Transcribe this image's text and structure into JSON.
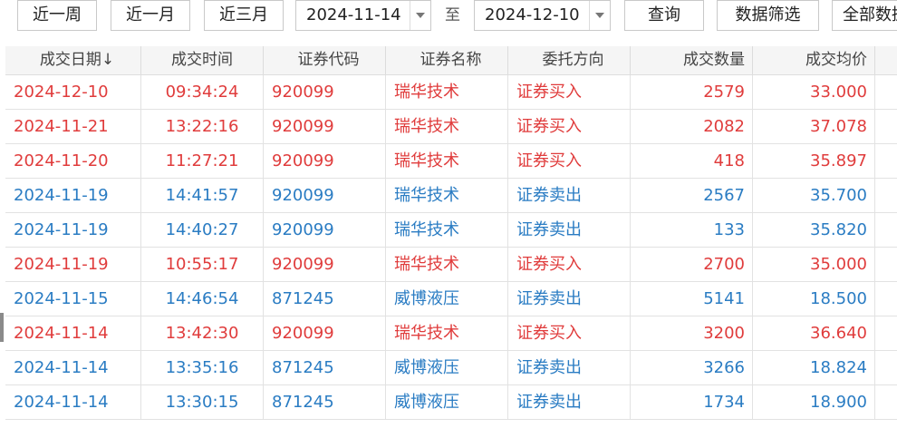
{
  "toolbar": {
    "quick_ranges": [
      "近一周",
      "近一月",
      "近三月"
    ],
    "start_date": "2024-11-14",
    "to_label": "至",
    "end_date": "2024-12-10",
    "query_label": "查询",
    "filter_label": "数据筛选",
    "all_label": "全部数据"
  },
  "colors": {
    "buy": "#e03c3c",
    "sell": "#2a7cc3"
  },
  "table": {
    "columns": [
      "成交日期↓",
      "成交时间",
      "证券代码",
      "证券名称",
      "委托方向",
      "成交数量",
      "成交均价",
      ""
    ],
    "rows": [
      {
        "side": "buy",
        "cells": [
          "2024-12-10",
          "09:34:24",
          "920099",
          "瑞华技术",
          "证券买入",
          "2579",
          "33.000",
          ""
        ]
      },
      {
        "side": "buy",
        "cells": [
          "2024-11-21",
          "13:22:16",
          "920099",
          "瑞华技术",
          "证券买入",
          "2082",
          "37.078",
          ""
        ]
      },
      {
        "side": "buy",
        "cells": [
          "2024-11-20",
          "11:27:21",
          "920099",
          "瑞华技术",
          "证券买入",
          "418",
          "35.897",
          ""
        ]
      },
      {
        "side": "sell",
        "cells": [
          "2024-11-19",
          "14:41:57",
          "920099",
          "瑞华技术",
          "证券卖出",
          "2567",
          "35.700",
          ""
        ]
      },
      {
        "side": "sell",
        "cells": [
          "2024-11-19",
          "14:40:27",
          "920099",
          "瑞华技术",
          "证券卖出",
          "133",
          "35.820",
          ""
        ]
      },
      {
        "side": "buy",
        "cells": [
          "2024-11-19",
          "10:55:17",
          "920099",
          "瑞华技术",
          "证券买入",
          "2700",
          "35.000",
          ""
        ]
      },
      {
        "side": "sell",
        "cells": [
          "2024-11-15",
          "14:46:54",
          "871245",
          "威博液压",
          "证券卖出",
          "5141",
          "18.500",
          ""
        ]
      },
      {
        "side": "buy",
        "cells": [
          "2024-11-14",
          "13:42:30",
          "920099",
          "瑞华技术",
          "证券买入",
          "3200",
          "36.640",
          ""
        ]
      },
      {
        "side": "sell",
        "cells": [
          "2024-11-14",
          "13:35:16",
          "871245",
          "威博液压",
          "证券卖出",
          "3266",
          "18.824",
          ""
        ]
      },
      {
        "side": "sell",
        "cells": [
          "2024-11-14",
          "13:30:15",
          "871245",
          "威博液压",
          "证券卖出",
          "1734",
          "18.900",
          ""
        ]
      }
    ]
  }
}
